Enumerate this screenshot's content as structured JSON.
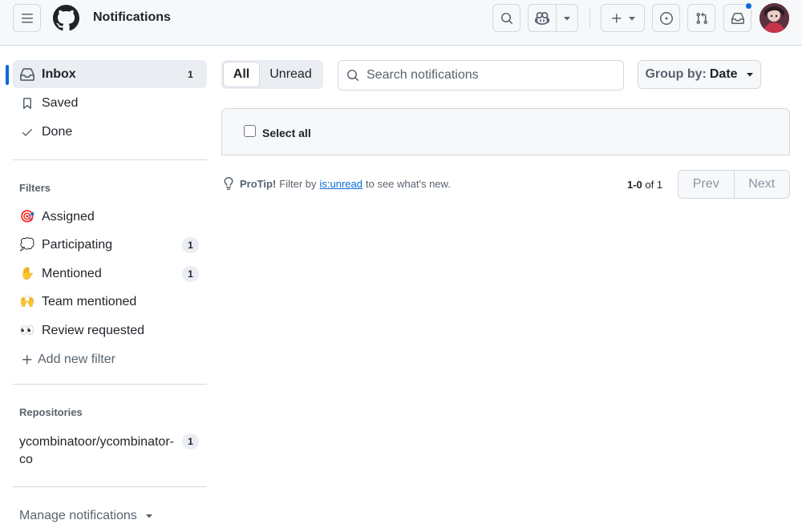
{
  "header": {
    "title": "Notifications",
    "icons": [
      "menu-icon",
      "github-logo",
      "search-icon",
      "copilot-icon",
      "chevron-down-icon",
      "plus-icon",
      "issue-icon",
      "pull-request-icon",
      "inbox-icon",
      "avatar"
    ],
    "inbox_has_unread": true
  },
  "sidebar": {
    "inbox": {
      "label": "Inbox",
      "count": "1",
      "icon": "inbox-icon"
    },
    "saved": {
      "label": "Saved",
      "icon": "bookmark-icon"
    },
    "done": {
      "label": "Done",
      "icon": "check-icon"
    },
    "filters_title": "Filters",
    "filters": [
      {
        "label": "Assigned",
        "icon": "🎯",
        "count": ""
      },
      {
        "label": "Participating",
        "icon": "💭",
        "count": "1"
      },
      {
        "label": "Mentioned",
        "icon": "✋",
        "count": "1"
      },
      {
        "label": "Team mentioned",
        "icon": "🙌",
        "count": ""
      },
      {
        "label": "Review requested",
        "icon": "👀",
        "count": ""
      }
    ],
    "add_filter": "Add new filter",
    "repositories_title": "Repositories",
    "repositories": [
      {
        "label": "ycombinatoor/ycombinator-co",
        "count": "1"
      }
    ],
    "manage": "Manage notifications"
  },
  "main": {
    "tabs": {
      "all": "All",
      "unread": "Unread",
      "selected": "All"
    },
    "search": {
      "placeholder": "Search notifications",
      "value": ""
    },
    "group_by": {
      "label": "Group by:",
      "value": "Date"
    },
    "select_all": "Select all",
    "protip": {
      "strong": "ProTip!",
      "before": "Filter by",
      "link": "is:unread",
      "after": "to see what's new."
    },
    "pagination": {
      "range": "1-0",
      "of": "of 1",
      "prev": "Prev",
      "next": "Next"
    }
  },
  "colors": {
    "accent": "#0969da",
    "border": "#d1d9e0",
    "muted": "#59636e",
    "canvas_subtle": "#f6f8fa"
  }
}
